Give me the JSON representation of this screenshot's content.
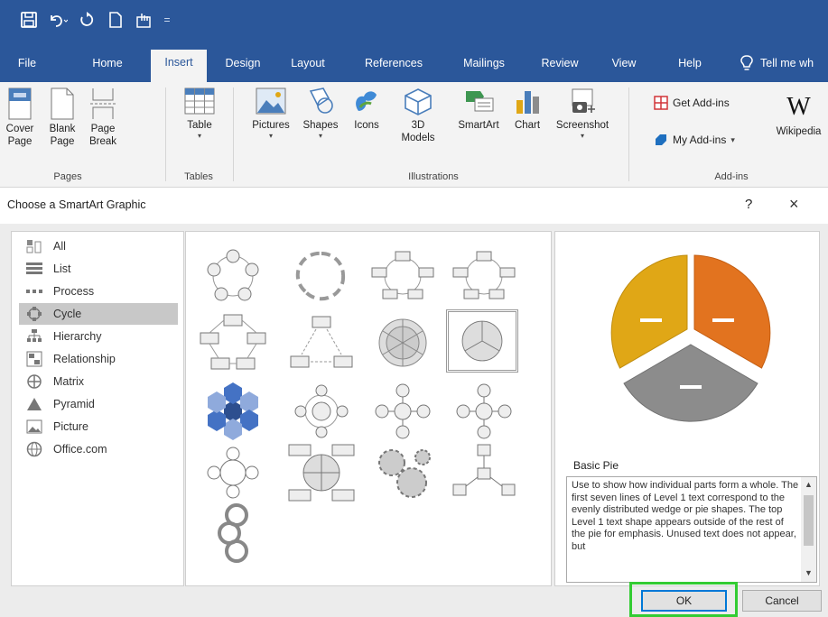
{
  "quick_access": {
    "icons": [
      "save-icon",
      "undo-icon",
      "redo-icon",
      "new-document-icon",
      "touch-mode-icon",
      "customize-qat-icon"
    ],
    "separator": "="
  },
  "tabs": [
    {
      "label": "File"
    },
    {
      "label": "Home"
    },
    {
      "label": "Insert",
      "active": true
    },
    {
      "label": "Design"
    },
    {
      "label": "Layout"
    },
    {
      "label": "References"
    },
    {
      "label": "Mailings"
    },
    {
      "label": "Review"
    },
    {
      "label": "View"
    },
    {
      "label": "Help"
    },
    {
      "label": "Tell me wh"
    }
  ],
  "ribbon": {
    "groups": {
      "pages": "Pages",
      "tables": "Tables",
      "illustrations": "Illustrations",
      "addins": "Add-ins"
    },
    "buttons": {
      "cover_page": "Cover\nPage",
      "blank_page": "Blank\nPage",
      "page_break": "Page\nBreak",
      "table": "Table",
      "pictures": "Pictures",
      "shapes": "Shapes",
      "icons": "Icons",
      "models_3d": "3D\nModels",
      "smartart": "SmartArt",
      "chart": "Chart",
      "screenshot": "Screenshot",
      "get_addins": "Get Add-ins",
      "my_addins": "My Add-ins",
      "wikipedia": "Wikipedia"
    }
  },
  "dialog": {
    "title": "Choose a SmartArt Graphic",
    "help": "?",
    "close": "×",
    "categories": [
      {
        "label": "All",
        "icon": "all-icon"
      },
      {
        "label": "List",
        "icon": "list-icon"
      },
      {
        "label": "Process",
        "icon": "process-icon"
      },
      {
        "label": "Cycle",
        "icon": "cycle-icon",
        "selected": true
      },
      {
        "label": "Hierarchy",
        "icon": "hierarchy-icon"
      },
      {
        "label": "Relationship",
        "icon": "relationship-icon"
      },
      {
        "label": "Matrix",
        "icon": "matrix-icon"
      },
      {
        "label": "Pyramid",
        "icon": "pyramid-icon"
      },
      {
        "label": "Picture",
        "icon": "picture-icon"
      },
      {
        "label": "Office.com",
        "icon": "office-com-icon"
      }
    ],
    "preview": {
      "name": "Basic Pie",
      "description": "Use to show how individual parts form a whole. The first seven lines of Level 1 text correspond to the evenly distributed wedge or pie shapes. The top Level 1 text shape appears outside of the rest of the pie for emphasis. Unused text does not appear, but",
      "colors": {
        "orange": "#e2731f",
        "gold": "#e0a716",
        "gray": "#8c8c8c"
      }
    },
    "ok_label": "OK",
    "cancel_label": "Cancel"
  }
}
